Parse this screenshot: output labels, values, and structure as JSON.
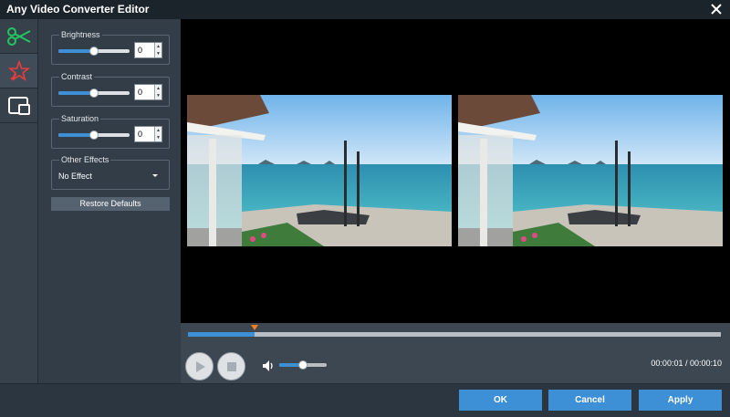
{
  "window": {
    "title": "Any Video Converter Editor",
    "close_icon": "close-icon"
  },
  "tabs": [
    {
      "icon": "scissors-icon",
      "active": false
    },
    {
      "icon": "effects-star-icon",
      "active": true
    },
    {
      "icon": "crop-watermark-icon",
      "active": false
    }
  ],
  "effects": {
    "brightness": {
      "label": "Brightness",
      "value": "0",
      "level": 0.5
    },
    "contrast": {
      "label": "Contrast",
      "value": "0",
      "level": 0.5
    },
    "saturation": {
      "label": "Saturation",
      "value": "0",
      "level": 0.5
    },
    "other": {
      "label": "Other Effects",
      "selected": "No Effect"
    },
    "restore_label": "Restore Defaults"
  },
  "player": {
    "progress": 0.125,
    "volume": 0.5,
    "time": "00:00:01 / 00:00:10"
  },
  "footer": {
    "ok": "OK",
    "cancel": "Cancel",
    "apply": "Apply"
  },
  "colors": {
    "accent": "#3d8fd6",
    "marker": "#ff7a1a",
    "background": "#2f3a45"
  }
}
